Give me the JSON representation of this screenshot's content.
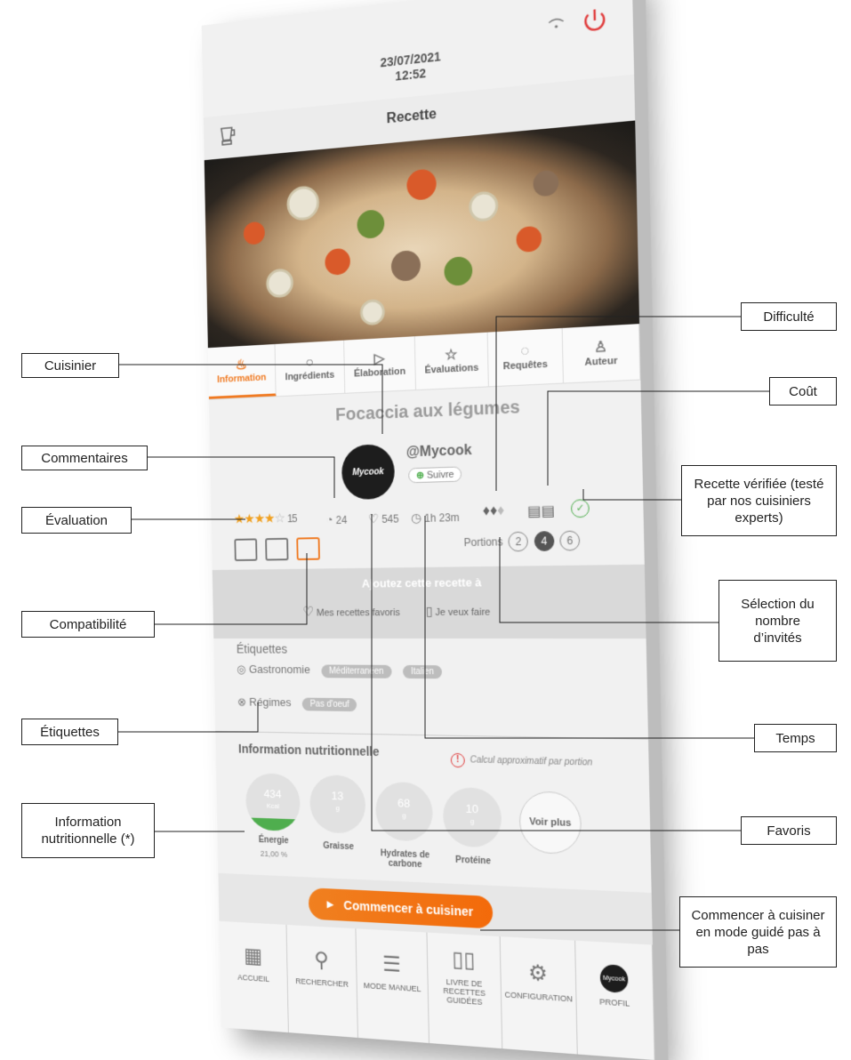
{
  "status": {
    "date": "23/07/2021",
    "time": "12:52"
  },
  "header": {
    "title": "Recette"
  },
  "tabs": [
    {
      "label": "Information",
      "icon": "pot-icon"
    },
    {
      "label": "Ingrédients",
      "icon": "apple-icon"
    },
    {
      "label": "Élaboration",
      "icon": "play-icon"
    },
    {
      "label": "Évaluations",
      "icon": "star-icon"
    },
    {
      "label": "Requêtes",
      "icon": "chat-icon"
    },
    {
      "label": "Auteur",
      "icon": "user-icon"
    }
  ],
  "recipe": {
    "title": "Focaccia aux légumes",
    "author": "@Mycook",
    "author_avatar_text": "Mycook",
    "follow_label": "Suivre",
    "rating_value": 4,
    "rating_max": 5,
    "rating_count": "15",
    "comments": "24",
    "favorites": "545",
    "time": "1h 23m",
    "portions_label": "Portions",
    "portions": [
      "2",
      "4",
      "6"
    ],
    "portions_selected": "4"
  },
  "add": {
    "title": "Ajoutez cette recette à",
    "favorites_label": "Mes recettes favoris",
    "todo_label": "Je veux faire"
  },
  "tags": {
    "title": "Étiquettes",
    "groups": [
      {
        "label": "Gastronomie",
        "chips": [
          "Méditerranéen",
          "Italien"
        ]
      },
      {
        "label": "Régimes",
        "chips": [
          "Pas d'oeuf"
        ]
      }
    ]
  },
  "nutrition": {
    "title": "Information nutritionnelle",
    "note": "Calcul approximatif par portion",
    "items": [
      {
        "value": "434",
        "unit": "Kcal",
        "label": "Énergie",
        "sub": "21,00 %",
        "fill": 0.21
      },
      {
        "value": "13",
        "unit": "g",
        "label": "Graisse",
        "sub": ""
      },
      {
        "value": "68",
        "unit": "g",
        "label": "Hydrates de carbone",
        "sub": ""
      },
      {
        "value": "10",
        "unit": "g",
        "label": "Protéine",
        "sub": ""
      }
    ],
    "more_label": "Voir plus"
  },
  "start_button": "Commencer à cuisiner",
  "nav": [
    {
      "label": "ACCUEIL",
      "icon": "grid-icon"
    },
    {
      "label": "RECHERCHER",
      "icon": "search-icon"
    },
    {
      "label": "MODE MANUEL",
      "icon": "sliders-icon"
    },
    {
      "label": "LIVRE DE RECETTES GUIDÉES",
      "icon": "book-icon"
    },
    {
      "label": "CONFIGURATION",
      "icon": "gear-icon"
    },
    {
      "label": "PROFIL",
      "icon": "profile-icon"
    }
  ],
  "callouts": {
    "cuisinier": "Cuisinier",
    "commentaires": "Commentaires",
    "evaluation": "Évaluation",
    "compatibilite": "Compatibilité",
    "etiquettes": "Étiquettes",
    "info_nutri": "Information nutritionnelle (*)",
    "difficulte": "Difficulté",
    "cout": "Coût",
    "verifiee": "Recette vérifiée (testé par nos cuisiniers experts)",
    "invites": "Sélection du nombre d’invités",
    "temps": "Temps",
    "favoris": "Favoris",
    "commencer": "Commencer à cuisiner en mode guidé pas à pas"
  },
  "colors": {
    "accent": "#f07a22",
    "verified": "#4fae4e",
    "warning": "#e03c3c"
  }
}
